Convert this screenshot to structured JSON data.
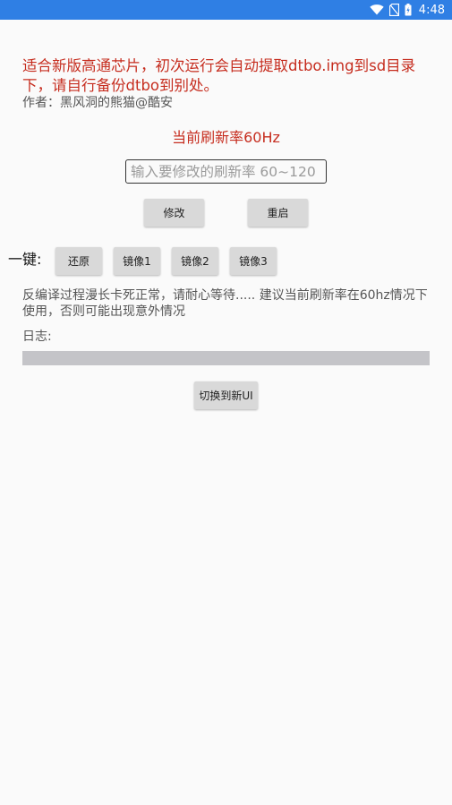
{
  "status_bar": {
    "time": "4:48",
    "background_color": "#2f7fe4",
    "icons": [
      "wifi-icon",
      "no-sim-icon",
      "battery-icon"
    ]
  },
  "main": {
    "warning_text": "适合新版高通芯片，初次运行会自动提取dtbo.img到sd目录下，请自行备份dtbo到别处。",
    "author_text": "作者：黑风洞的熊猫@酷安",
    "current_rate_text": "当前刷新率60Hz",
    "rate_input": {
      "value": "",
      "placeholder": "输入要修改的刷新率 60~120"
    },
    "modify_button": "修改",
    "restart_button": "重启",
    "onekey_label": "一键:",
    "restore_button": "还原",
    "mirror1_button": "镜像1",
    "mirror2_button": "镜像2",
    "mirror3_button": "镜像3",
    "tip_text": "反编译过程漫长卡死正常，请耐心等待..... 建议当前刷新率在60hz情况下使用，否则可能出现意外情况",
    "log_label": "日志:",
    "switch_ui_button": "切换到新UI"
  },
  "colors": {
    "accent_red": "#c62d1f",
    "button_gray": "#d9d9d9",
    "log_bar": "#c4c4c8",
    "background": "#fafafa"
  }
}
